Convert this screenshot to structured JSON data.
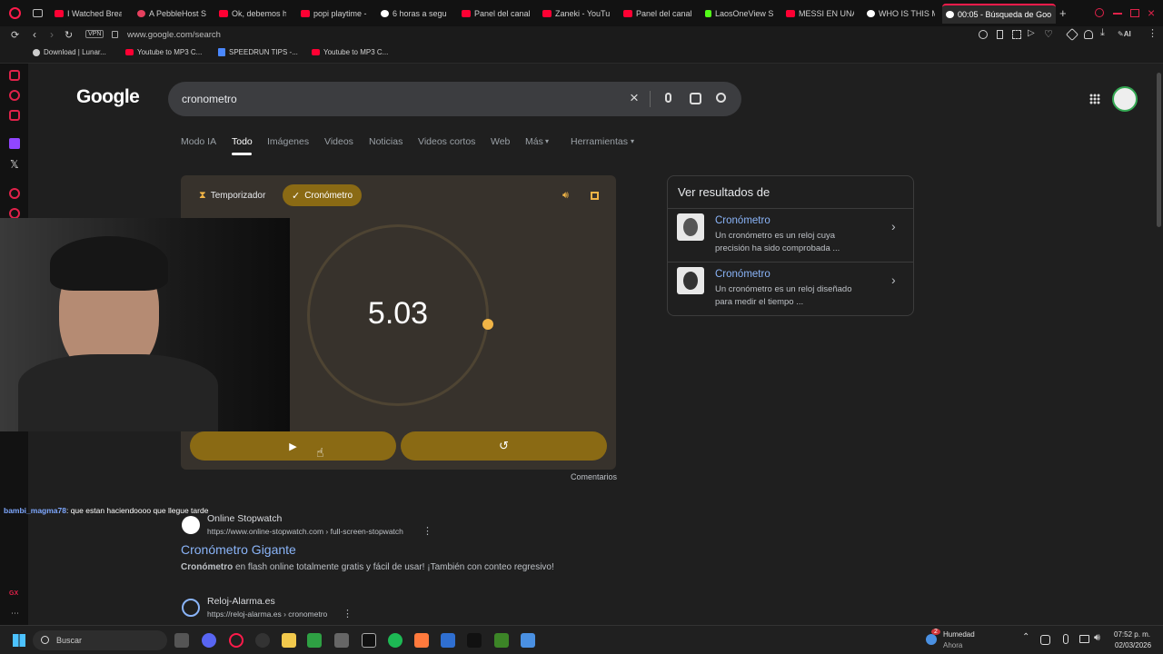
{
  "tabs": [
    {
      "label": "I Watched Break"
    },
    {
      "label": "A PebbleHost S"
    },
    {
      "label": "Ok, debemos h"
    },
    {
      "label": "popi playtime -"
    },
    {
      "label": "6 horas a segu"
    },
    {
      "label": "Panel del canal"
    },
    {
      "label": "Zaneki - YouTu"
    },
    {
      "label": "Panel del canal"
    },
    {
      "label": "LaosOneView S"
    },
    {
      "label": "MESSI EN UNA"
    },
    {
      "label": "WHO IS THIS M"
    },
    {
      "label": "00:05 - Búsqueda de Goo"
    }
  ],
  "address": {
    "vpn": "VPN",
    "url": "www.google.com/search"
  },
  "bookmarks": [
    {
      "label": "Download | Lunar..."
    },
    {
      "label": "Youtube to MP3 C..."
    },
    {
      "label": "SPEEDRUN TIPS -..."
    },
    {
      "label": "Youtube to MP3 C..."
    }
  ],
  "google": {
    "logo": "Google",
    "query": "cronometro",
    "nav": [
      "Modo IA",
      "Todo",
      "Imágenes",
      "Videos",
      "Noticias",
      "Videos cortos",
      "Web",
      "Más",
      "Herramientas"
    ]
  },
  "stopwatch": {
    "timer_label": "Temporizador",
    "stopwatch_label": "Cronómetro",
    "time": "5.03",
    "comments": "Comentarios"
  },
  "panel": {
    "title": "Ver resultados de",
    "items": [
      {
        "title": "Cronómetro",
        "desc": "Un cronómetro es un reloj cuya precisión ha sido comprobada ..."
      },
      {
        "title": "Cronómetro",
        "desc": "Un cronómetro es un reloj diseñado para medir el tiempo ..."
      }
    ]
  },
  "results": [
    {
      "site": "Online Stopwatch",
      "url": "https://www.online-stopwatch.com › full-screen-stopwatch",
      "title": "Cronómetro Gigante",
      "snippet_bold": "Cronómetro",
      "snippet": " en flash online totalmente gratis y fácil de usar! ¡También con conteo regresivo!"
    },
    {
      "site": "Reloj-Alarma.es",
      "url": "https://reloj-alarma.es › cronometro"
    }
  ],
  "chat": {
    "user": "bambi_magma78",
    "message": ": que estan haciendoooo que llegue tarde"
  },
  "taskbar": {
    "search": "Buscar",
    "weather_title": "Humedad",
    "weather_sub": "Ahora",
    "weather_badge": "2",
    "time": "07:52 p. m.",
    "date": "02/03/2026"
  },
  "colors": {
    "accent": "#8a6a14",
    "dot": "#f0b446",
    "link": "#8ab4f8",
    "opera": "#ff1b4b"
  }
}
